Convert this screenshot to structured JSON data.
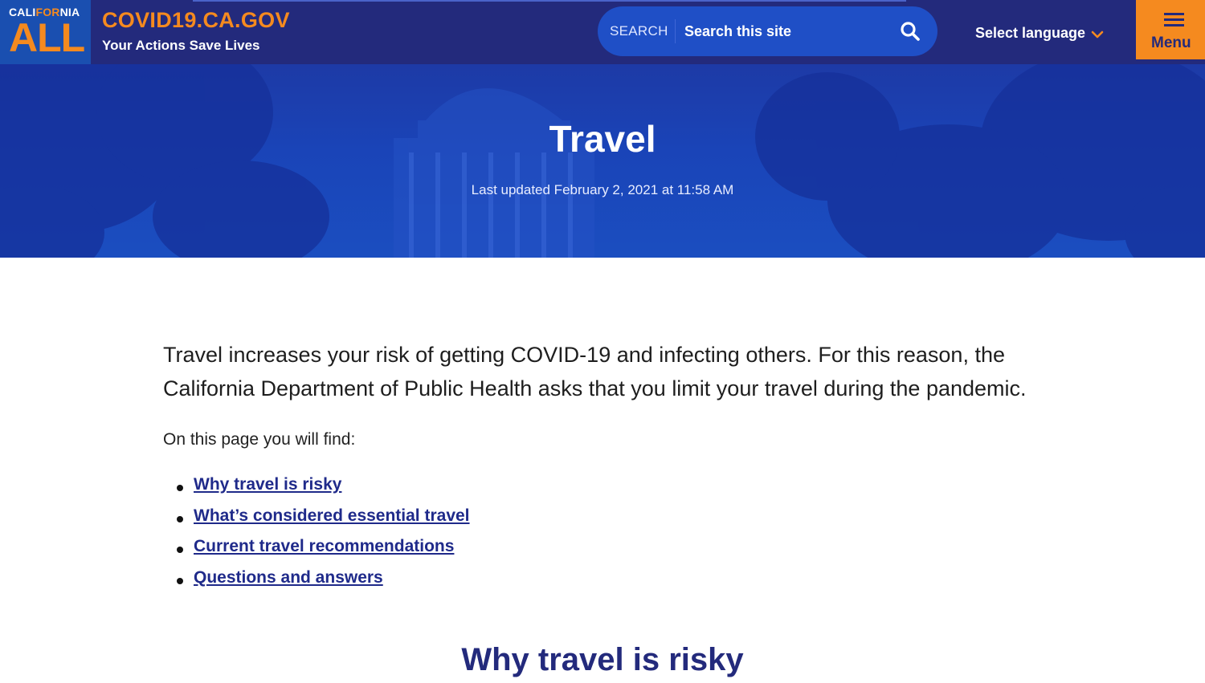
{
  "header": {
    "logo_line1_a": "CALI",
    "logo_line1_b": "FOR",
    "logo_line1_c": "NIA",
    "logo_line2": "ALL",
    "site_title": "COVID19.CA.GOV",
    "tagline": "Your Actions Save Lives",
    "search_label": "SEARCH",
    "search_placeholder": "Search this site",
    "language_label": "Select language",
    "menu_label": "Menu"
  },
  "hero": {
    "title": "Travel",
    "updated": "Last updated February 2, 2021 at 11:58 AM"
  },
  "content": {
    "intro": "Travel increases your risk of getting COVID-19 and infecting others. For this reason, the California Department of Public Health asks that you limit your travel during the pandemic.",
    "find_label": "On this page you will find:",
    "links": [
      "Why travel is risky",
      "What’s considered essential travel",
      "Current travel recommendations",
      "Questions and answers"
    ],
    "section_heading": "Why travel is risky"
  },
  "colors": {
    "navy": "#232a7c",
    "accent_orange": "#f58a1f",
    "hero_blue": "#1a44b8",
    "link": "#1f2a8a"
  },
  "icons": [
    "search-icon",
    "chevron-down-icon",
    "hamburger-icon"
  ]
}
